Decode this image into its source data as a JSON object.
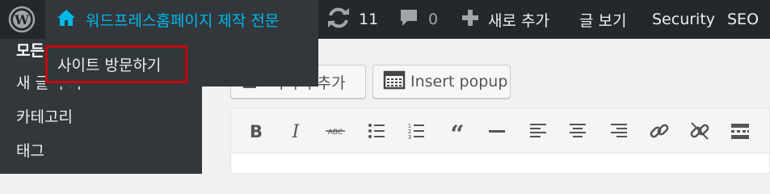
{
  "admin_bar": {
    "site_name": "워드프레스홈페이지 제작 전문",
    "updates_count": "11",
    "comments_count": "0",
    "new_label": "새로 추가",
    "view_post_label": "글 보기",
    "security_label": "Security",
    "seo_label": "SEO",
    "site_dropdown": {
      "visit_site_label": "사이트 방문하기"
    }
  },
  "sidebar": {
    "items": [
      {
        "label": "모든 글"
      },
      {
        "label": "새 글 추가"
      },
      {
        "label": "카테고리"
      },
      {
        "label": "태그"
      }
    ]
  },
  "editor": {
    "add_media_label": "미디어 추가",
    "insert_popup_label": "Insert popup",
    "toolbar_icons": [
      "bold-icon",
      "italic-icon",
      "strikethrough-icon",
      "bullet-list-icon",
      "numbered-list-icon",
      "blockquote-icon",
      "horizontal-line-icon",
      "align-left-icon",
      "align-center-icon",
      "align-right-icon",
      "link-icon",
      "unlink-icon",
      "read-more-icon"
    ]
  },
  "colors": {
    "admin_bar_bg": "#23282d",
    "menu_bg": "#32373c",
    "accent": "#00b9eb",
    "highlight_border": "#c6000c"
  }
}
